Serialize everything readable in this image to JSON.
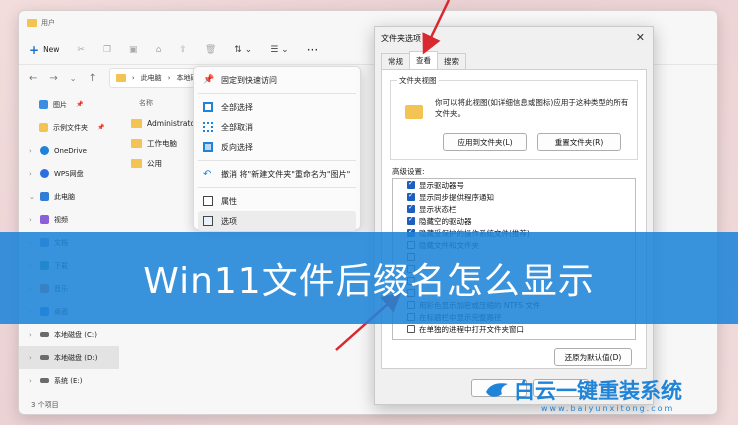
{
  "window": {
    "title": "用户",
    "new_label": "New",
    "breadcrumb": [
      "此电脑",
      "本地磁"
    ],
    "status": "3 个项目"
  },
  "sidebar": {
    "items": [
      {
        "label": "图片",
        "icon": "pictures-icon",
        "pinned": true
      },
      {
        "label": "示例文件夹",
        "icon": "folder-icon",
        "pinned": true
      },
      {
        "label": "OneDrive",
        "icon": "onedrive-icon",
        "pinned": false
      },
      {
        "label": "WPS网盘",
        "icon": "cloud-icon",
        "pinned": false
      },
      {
        "label": "此电脑",
        "icon": "pc-icon",
        "pinned": false
      },
      {
        "label": "视频",
        "icon": "video-icon",
        "pinned": false
      },
      {
        "label": "文档",
        "icon": "document-icon",
        "pinned": false
      },
      {
        "label": "下载",
        "icon": "download-icon",
        "pinned": false
      },
      {
        "label": "音乐",
        "icon": "music-icon",
        "pinned": false
      },
      {
        "label": "桌面",
        "icon": "desktop-icon",
        "pinned": false
      },
      {
        "label": "本地磁盘 (C:)",
        "icon": "drive-icon",
        "pinned": false
      },
      {
        "label": "本地磁盘 (D:)",
        "icon": "drive-icon",
        "pinned": false
      },
      {
        "label": "系统 (E:)",
        "icon": "drive-icon",
        "pinned": false
      }
    ]
  },
  "files": {
    "column_name": "名称",
    "rows": [
      "Administrator",
      "工作电脑",
      "公用"
    ]
  },
  "context_menu": {
    "items": [
      {
        "label": "固定到快速访问",
        "icon": "pin-icon"
      },
      {
        "label": "全部选择",
        "icon": "select-all-icon"
      },
      {
        "label": "全部取消",
        "icon": "select-none-icon"
      },
      {
        "label": "反向选择",
        "icon": "invert-selection-icon"
      },
      {
        "label": "撤消 将\"新建文件夹\"重命名为\"图片\"",
        "icon": "undo-icon"
      },
      {
        "label": "属性",
        "icon": "properties-icon"
      },
      {
        "label": "选项",
        "icon": "options-icon"
      }
    ]
  },
  "dialog": {
    "title": "文件夹选项",
    "tabs": [
      "常规",
      "查看",
      "搜索"
    ],
    "active_tab": "查看",
    "group_title": "文件夹视图",
    "group_text": "你可以将此视图(如详细信息或图标)应用于这种类型的所有文件夹。",
    "apply_button": "应用到文件夹(L)",
    "reset_button": "重置文件夹(R)",
    "advanced_title": "高级设置:",
    "advanced_items": [
      {
        "label": "显示驱动器号",
        "checked": true
      },
      {
        "label": "显示同步提供程序通知",
        "checked": true
      },
      {
        "label": "显示状态栏",
        "checked": true
      },
      {
        "label": "隐藏空的驱动器",
        "checked": true
      },
      {
        "label": "隐藏受保护的操作系统文件(推荐)",
        "checked": true
      },
      {
        "label": "隐藏文件和文件夹",
        "checked": false
      },
      {
        "label": "",
        "checked": false
      },
      {
        "label": "",
        "checked": false
      },
      {
        "label": "",
        "checked": false
      },
      {
        "label": "",
        "checked": false
      },
      {
        "label": "用彩色显示加密或压缩的 NTFS 文件",
        "checked": false
      },
      {
        "label": "在标题栏中显示完整路径",
        "checked": false
      },
      {
        "label": "在单独的进程中打开文件夹窗口",
        "checked": false
      }
    ],
    "restore_button": "还原为默认值(D)"
  },
  "banner": {
    "text": "Win11文件后缀名怎么显示"
  },
  "watermark": {
    "brand": "白云一键重装系统",
    "url": "www.baiyunxitong.com"
  },
  "colors": {
    "banner": "#1f84d8",
    "arrow": "#d9282f",
    "folder": "#f3c454",
    "checkbox": "#1d5fbf"
  }
}
